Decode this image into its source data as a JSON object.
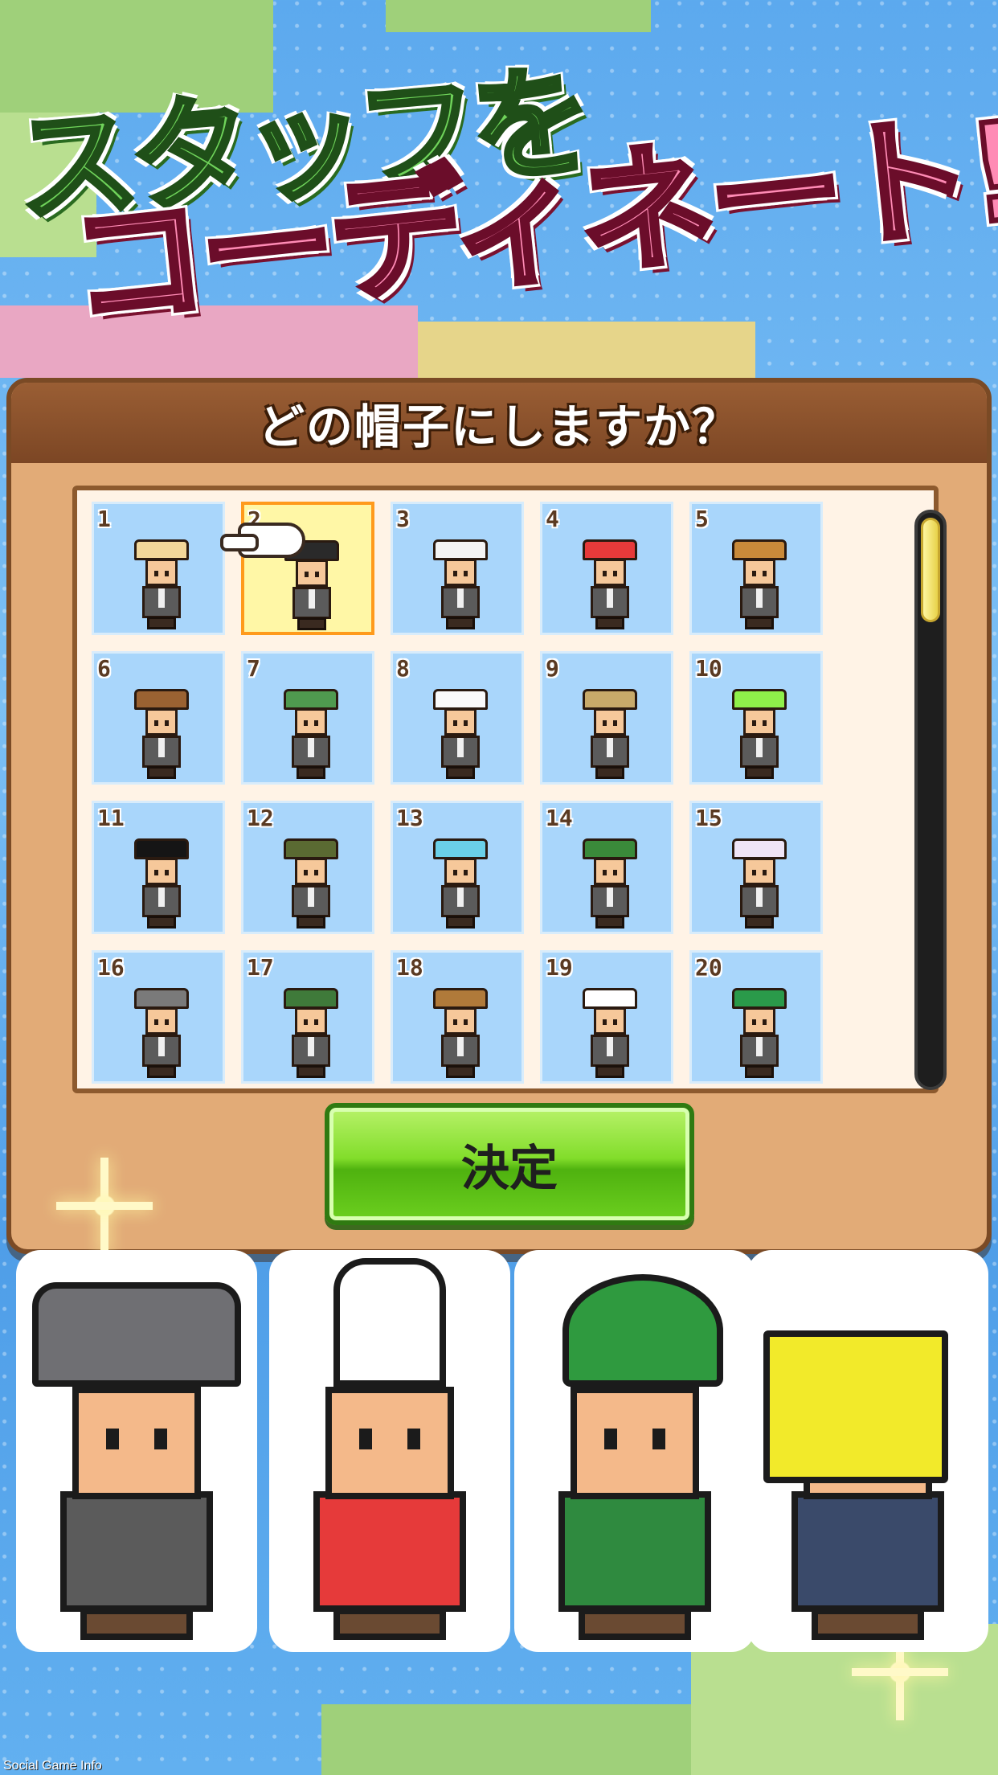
{
  "promo": {
    "line1": "スタッフを",
    "line2": "コーディネート!"
  },
  "dialog": {
    "title": "どの帽子にしますか？",
    "confirm_label": "決定",
    "selected_index": 2,
    "items": [
      {
        "num": "1",
        "hat_color": "#f2d79a",
        "hat_icon": "straw-hat-icon"
      },
      {
        "num": "2",
        "hat_color": "#2a2a2a",
        "hat_icon": "red-cap-icon"
      },
      {
        "num": "3",
        "hat_color": "#f4f4f4",
        "hat_icon": "cow-hood-icon"
      },
      {
        "num": "4",
        "hat_color": "#e63a3a",
        "hat_icon": "bunny-ears-icon"
      },
      {
        "num": "5",
        "hat_color": "#c98a3a",
        "hat_icon": "fedora-icon"
      },
      {
        "num": "6",
        "hat_color": "#9a6232",
        "hat_icon": "newsboy-cap-icon"
      },
      {
        "num": "7",
        "hat_color": "#4f9a4f",
        "hat_icon": "trapper-hat-icon"
      },
      {
        "num": "8",
        "hat_color": "#fafafa",
        "hat_icon": "chef-hat-icon"
      },
      {
        "num": "9",
        "hat_color": "#c8aa6a",
        "hat_icon": "bucket-hat-icon"
      },
      {
        "num": "10",
        "hat_color": "#8ff04a",
        "hat_icon": "visor-icon"
      },
      {
        "num": "11",
        "hat_color": "#151515",
        "hat_icon": "top-hat-icon"
      },
      {
        "num": "12",
        "hat_color": "#5a6a32",
        "hat_icon": "beanie-icon"
      },
      {
        "num": "13",
        "hat_color": "#6ad0e8",
        "hat_icon": "baseball-cap-icon"
      },
      {
        "num": "14",
        "hat_color": "#3a8a3a",
        "hat_icon": "tyrolean-hat-icon"
      },
      {
        "num": "15",
        "hat_color": "#efe4f6",
        "hat_icon": "lace-bonnet-icon"
      },
      {
        "num": "16",
        "hat_color": "#7a7a7a",
        "hat_icon": "knit-cap-icon"
      },
      {
        "num": "17",
        "hat_color": "#3f7a3a",
        "hat_icon": "flat-cap-icon"
      },
      {
        "num": "18",
        "hat_color": "#b07a3a",
        "hat_icon": "aviator-goggles-icon"
      },
      {
        "num": "19",
        "hat_color": "#ffffff",
        "hat_icon": "maid-headband-icon"
      },
      {
        "num": "20",
        "hat_color": "#2a9a4a",
        "hat_icon": "beret-icon"
      }
    ]
  },
  "showcase": [
    {
      "hat_icon": "gray-fedora-icon",
      "hat_color": "#6f6f73",
      "body_color": "#5b5b5b"
    },
    {
      "hat_icon": "bunny-ears-icon",
      "hat_color": "#ffffff",
      "body_color": "#e63a3a"
    },
    {
      "hat_icon": "green-leaf-hat-icon",
      "hat_color": "#2f9a3f",
      "body_color": "#2f8a3f"
    },
    {
      "hat_icon": "paper-bag-mask-icon",
      "hat_color": "#f2ea2a",
      "body_color": "#3a4a6a"
    }
  ],
  "watermark": "Social Game Info",
  "colors": {
    "panel": "#e2ab77",
    "panel_border": "#7a4a25",
    "cell": "#a9d6fb",
    "selected_border": "#ff9a1c",
    "button_green": "#82dd2b"
  }
}
